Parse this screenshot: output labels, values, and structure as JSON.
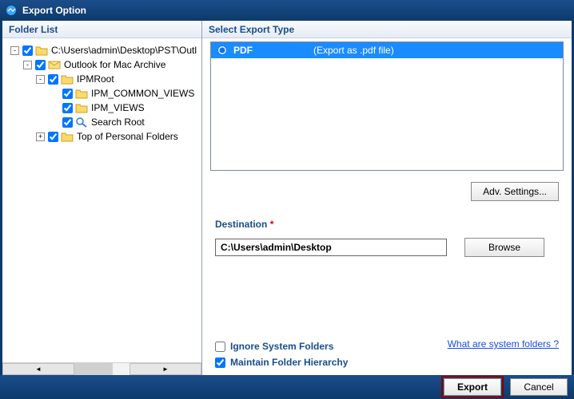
{
  "title": "Export Option",
  "left": {
    "header": "Folder List",
    "tree": [
      {
        "level": 0,
        "expander": "-",
        "checked": true,
        "icon": "folder",
        "label": "C:\\Users\\admin\\Desktop\\PST\\Outl"
      },
      {
        "level": 1,
        "expander": "-",
        "checked": true,
        "icon": "mailbox",
        "label": "Outlook for Mac Archive"
      },
      {
        "level": 2,
        "expander": "-",
        "checked": true,
        "icon": "folder",
        "label": "IPMRoot"
      },
      {
        "level": 3,
        "expander": "",
        "checked": true,
        "icon": "folder",
        "label": "IPM_COMMON_VIEWS"
      },
      {
        "level": 3,
        "expander": "",
        "checked": true,
        "icon": "folder",
        "label": "IPM_VIEWS"
      },
      {
        "level": 3,
        "expander": "",
        "checked": true,
        "icon": "search",
        "label": "Search Root"
      },
      {
        "level": 2,
        "expander": "+",
        "checked": true,
        "icon": "folder",
        "label": "Top of Personal Folders"
      }
    ]
  },
  "right": {
    "header": "Select Export Type",
    "rows": [
      {
        "selected": true,
        "format": "PDF",
        "desc": "(Export as .pdf file)"
      }
    ],
    "adv_settings": "Adv. Settings...",
    "destination_label": "Destination",
    "destination_value": "C:\\Users\\admin\\Desktop",
    "browse": "Browse",
    "ignore_label": "Ignore System Folders",
    "ignore_checked": false,
    "maintain_label": "Maintain Folder Hierarchy",
    "maintain_checked": true,
    "syslink": "What are system folders ?"
  },
  "footer": {
    "export": "Export",
    "cancel": "Cancel"
  }
}
